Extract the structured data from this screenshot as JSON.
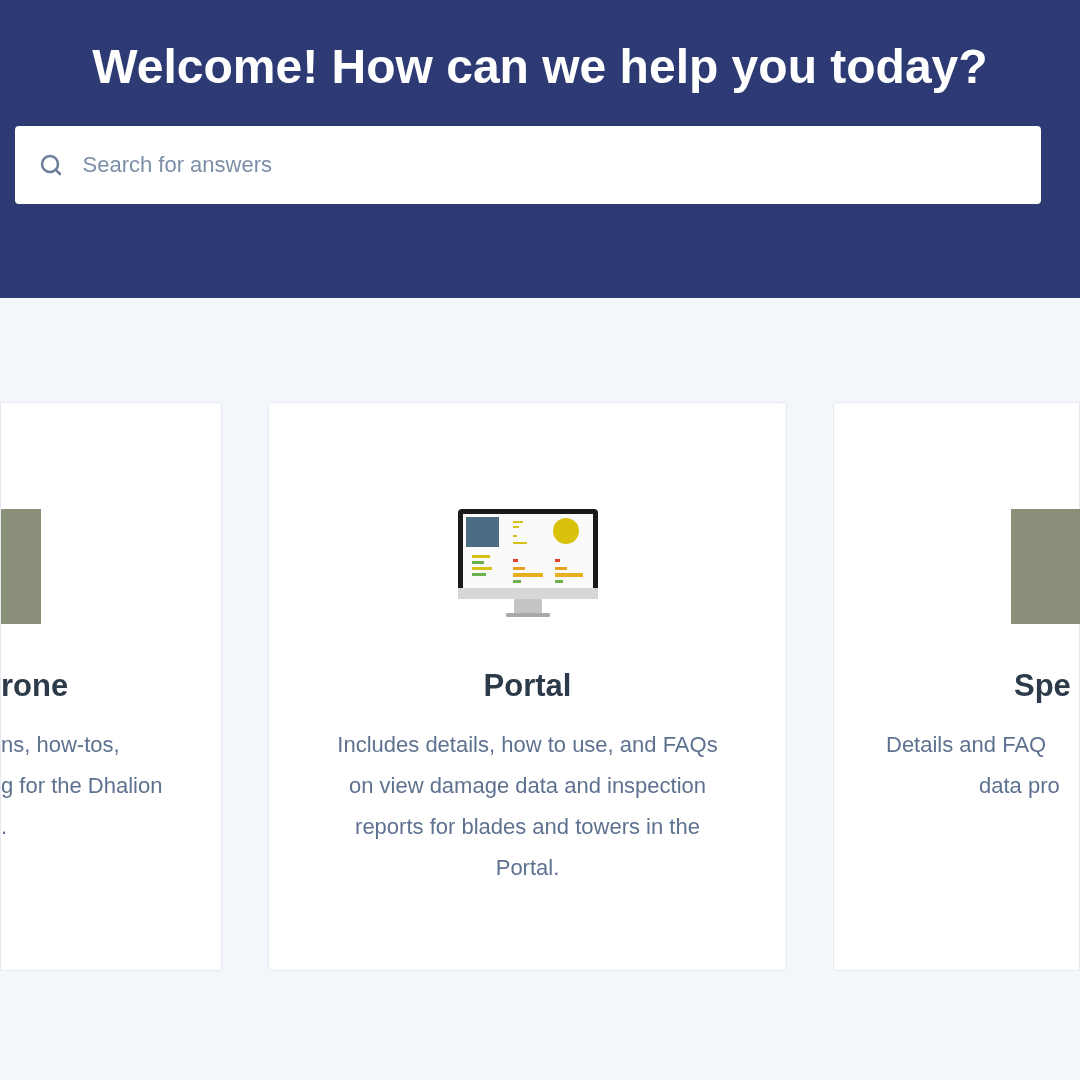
{
  "header": {
    "title": "Welcome! How can we help you today?",
    "search": {
      "placeholder": "Search for answers"
    }
  },
  "cards": [
    {
      "kind": "photo",
      "title": "rone",
      "description_lines": [
        "ns, how-tos,",
        "g for the Dhalion",
        "."
      ]
    },
    {
      "kind": "monitor",
      "title": "Portal",
      "description_lines": [
        "Includes details, how to use, and FAQs on view damage data and inspection reports for blades and towers in the Portal."
      ]
    },
    {
      "kind": "photo",
      "title": "Spe",
      "description_lines": [
        "Details and FAQ",
        "data pro"
      ]
    }
  ]
}
